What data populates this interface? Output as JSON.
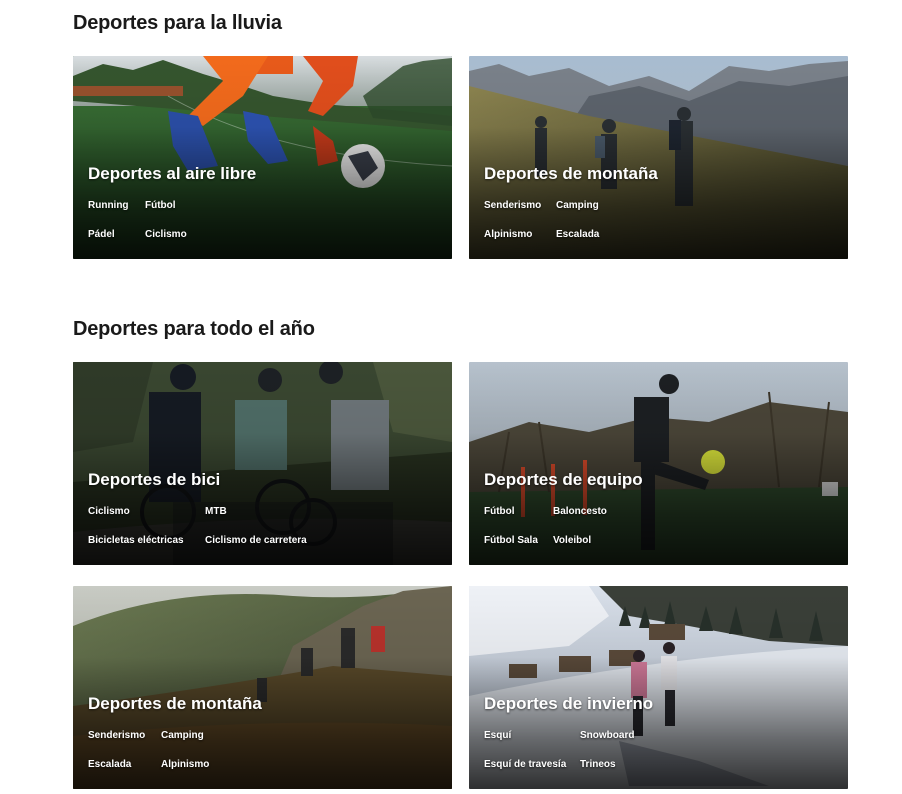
{
  "sections": [
    {
      "title": "Deportes para la lluvia",
      "cards": [
        {
          "title": "Deportes al aire libre",
          "tags": [
            "Running",
            "Fútbol",
            "Pádel",
            "Ciclismo"
          ]
        },
        {
          "title": "Deportes de montaña",
          "tags": [
            "Senderismo",
            "Camping",
            "Alpinismo",
            "Escalada"
          ]
        }
      ]
    },
    {
      "title": "Deportes para todo el año",
      "cards": [
        {
          "title": "Deportes de bici",
          "tags": [
            "Ciclismo",
            "MTB",
            "Bicicletas eléctricas",
            "Ciclismo de carretera"
          ]
        },
        {
          "title": "Deportes de equipo",
          "tags": [
            "Fútbol",
            "Baloncesto",
            "Fútbol Sala",
            "Voleibol"
          ]
        },
        {
          "title": "Deportes de montaña",
          "tags": [
            "Senderismo",
            "Camping",
            "Escalada",
            "Alpinismo"
          ]
        },
        {
          "title": "Deportes de invierno",
          "tags": [
            "Esquí",
            "Snowboard",
            "Esquí de travesía",
            "Trineos"
          ]
        }
      ]
    }
  ]
}
